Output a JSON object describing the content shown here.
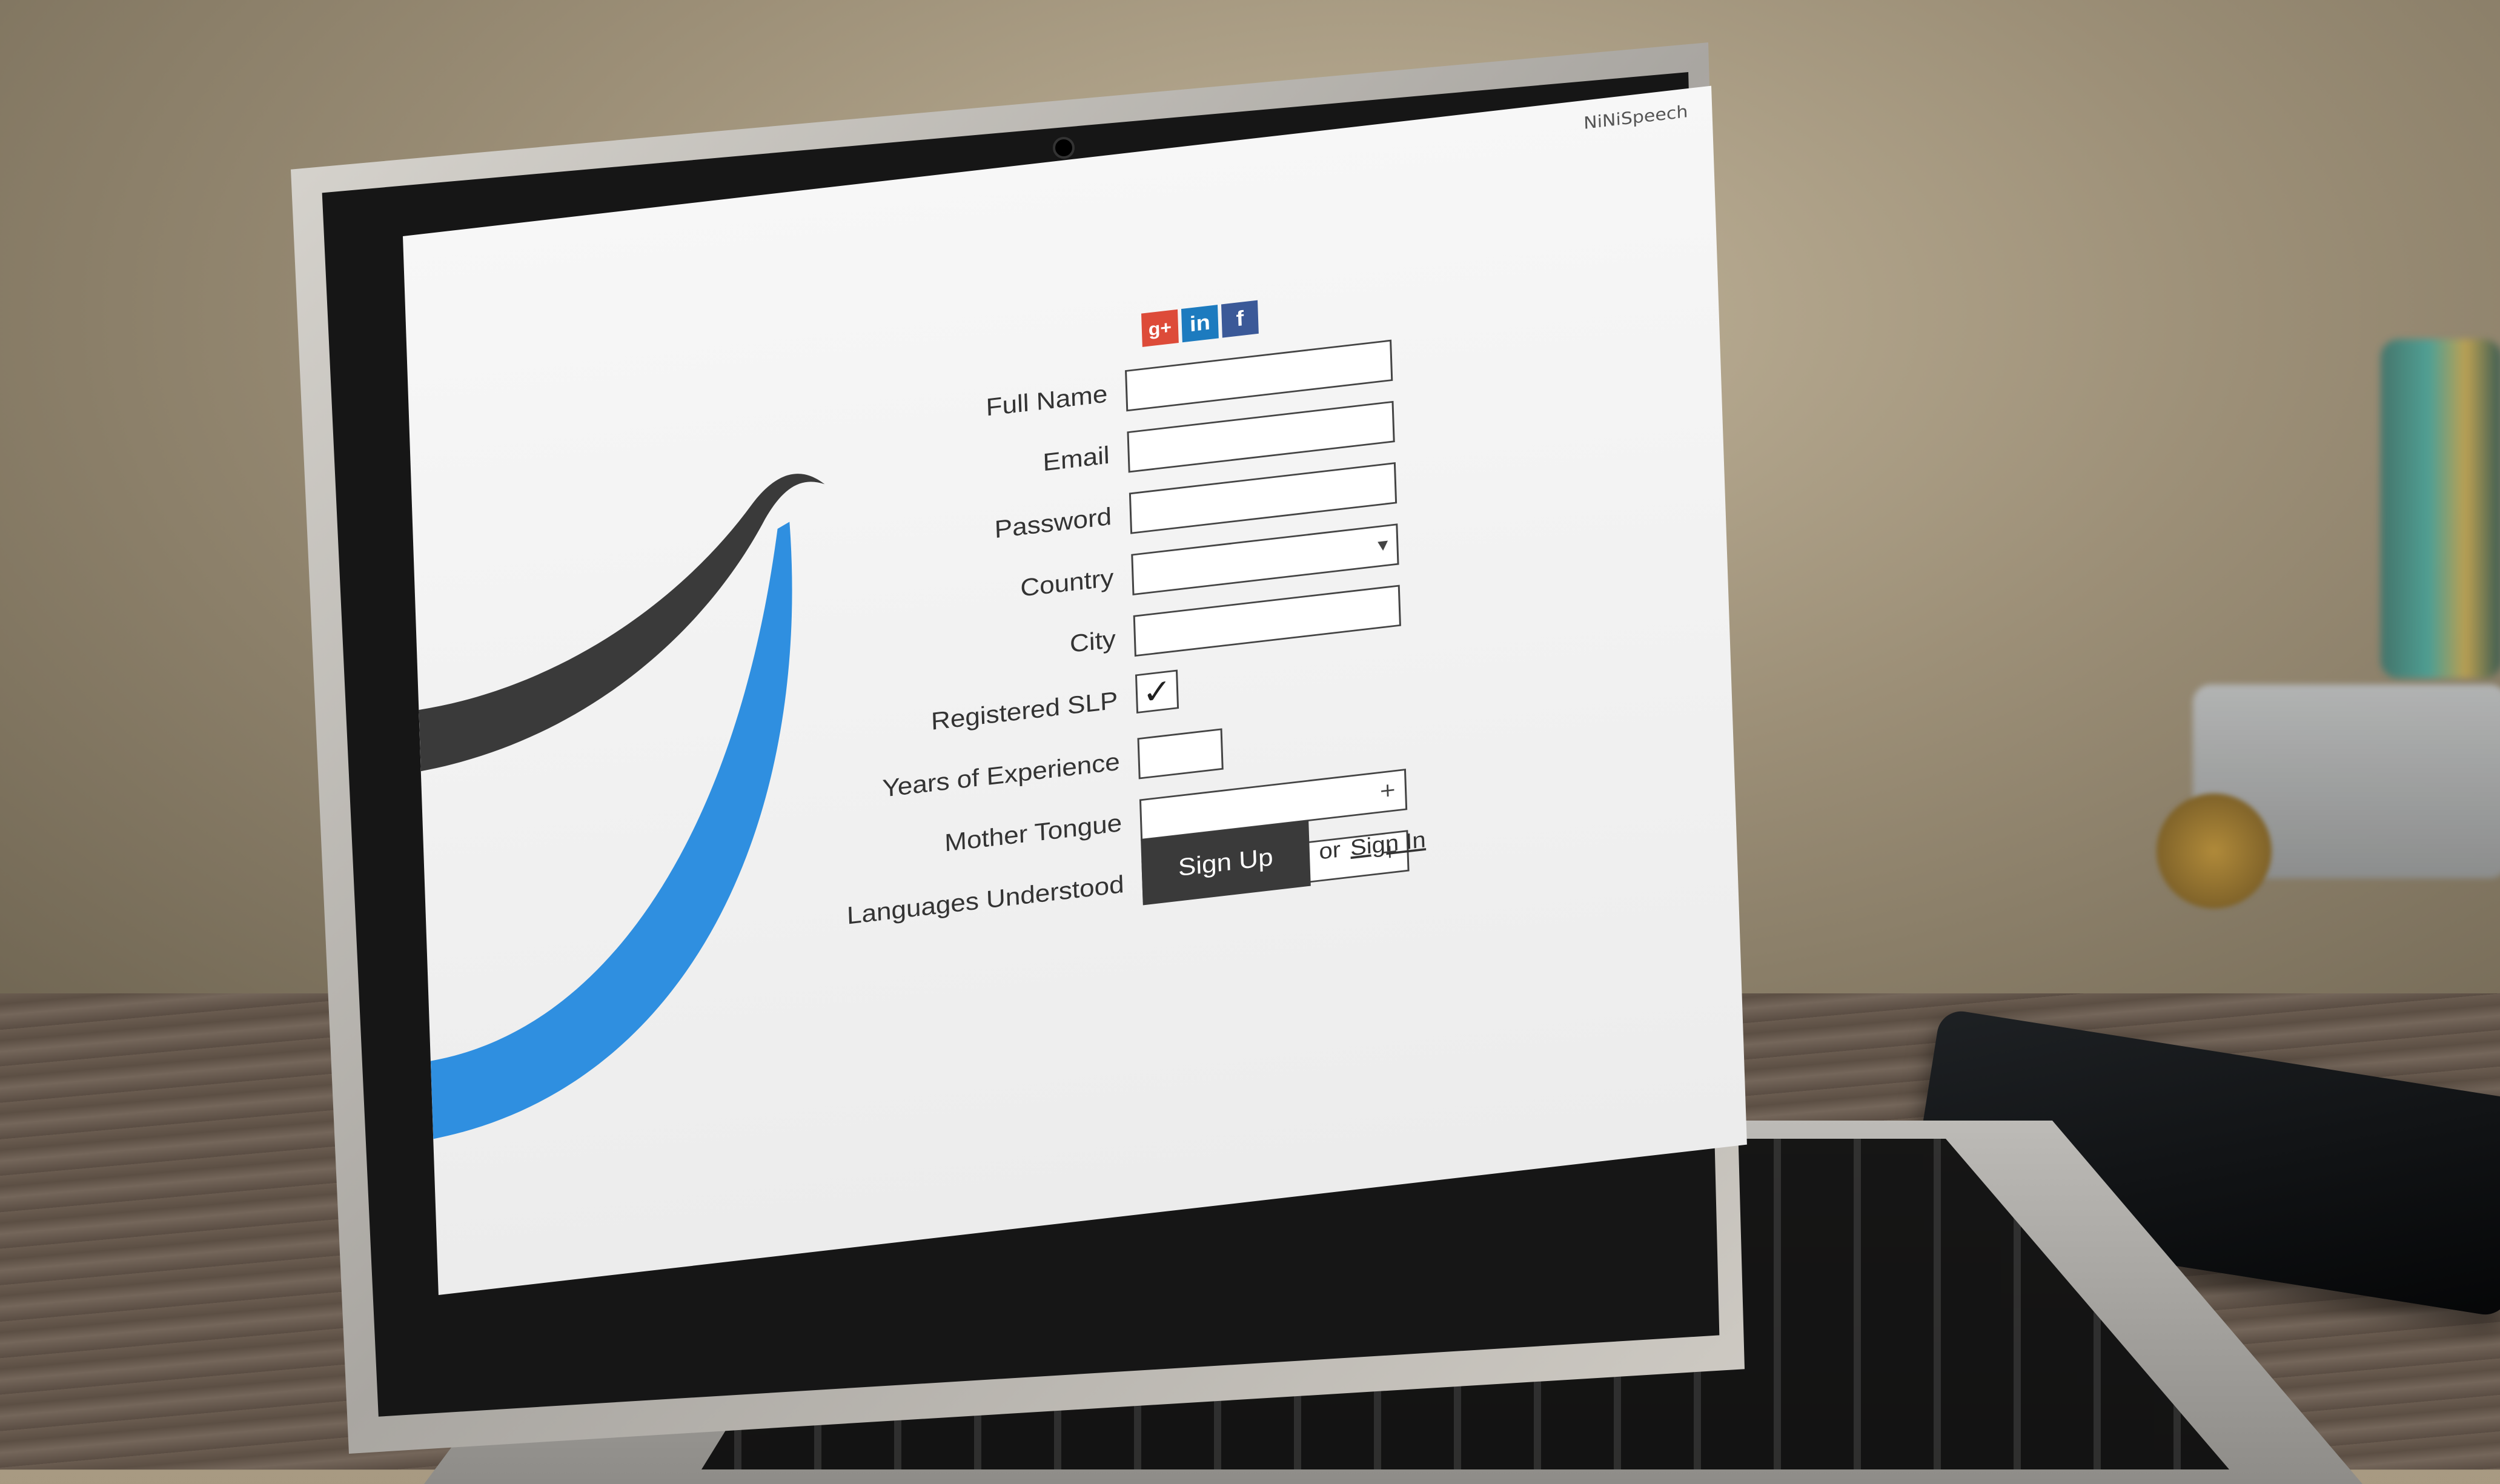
{
  "app": {
    "brand": "NiNiSpeech"
  },
  "social": [
    {
      "name": "google-plus",
      "glyph": "g+",
      "color": "#dd4b39"
    },
    {
      "name": "linkedin",
      "glyph": "in",
      "color": "#1d7bbf"
    },
    {
      "name": "facebook",
      "glyph": "f",
      "color": "#3b5998"
    }
  ],
  "form": {
    "full_name": {
      "label": "Full Name",
      "value": ""
    },
    "email": {
      "label": "Email",
      "value": ""
    },
    "password": {
      "label": "Password",
      "value": ""
    },
    "country": {
      "label": "Country",
      "value": "",
      "icon": "dropdown-arrow-icon",
      "glyph": "▾"
    },
    "city": {
      "label": "City",
      "value": ""
    },
    "registered_slp": {
      "label": "Registered SLP",
      "checked": true,
      "glyph": "✓"
    },
    "years_experience": {
      "label": "Years of Experience",
      "value": ""
    },
    "mother_tongue": {
      "label": "Mother Tongue",
      "value": "",
      "icon": "plus-icon",
      "glyph": "+"
    },
    "languages_understood": {
      "label": "Languages Understood",
      "value": "",
      "icon": "plus-icon",
      "glyph": "+"
    }
  },
  "actions": {
    "signup_label": "Sign Up",
    "or_text": "or",
    "signin_label": "Sign In"
  },
  "colors": {
    "logo_dark": "#3a3a3a",
    "logo_blue": "#2f8fe0",
    "button_bg": "#3a3a3a"
  }
}
